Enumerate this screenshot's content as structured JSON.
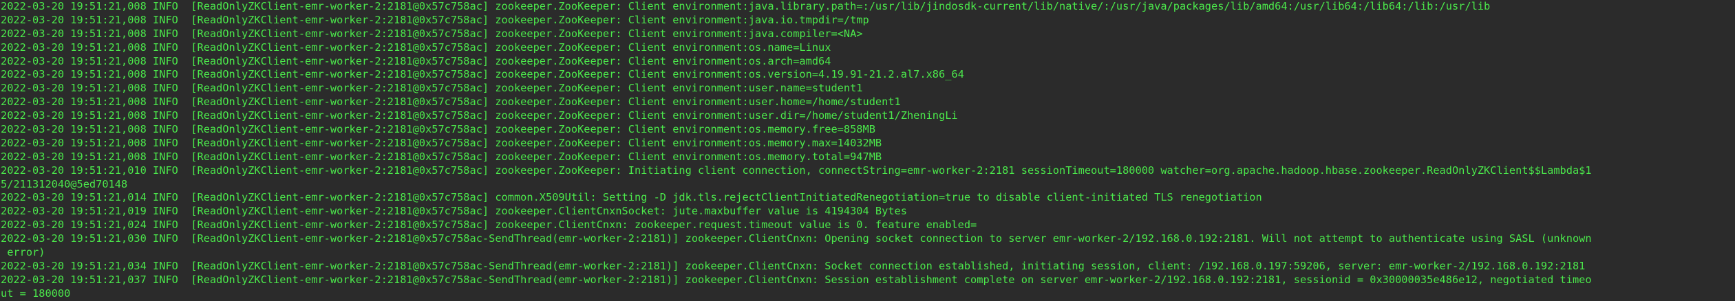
{
  "terminal": {
    "text_color": "#4be84b",
    "background_color": "#2b2b2b",
    "lines": [
      "2022-03-20 19:51:21,008 INFO  [ReadOnlyZKClient-emr-worker-2:2181@0x57c758ac] zookeeper.ZooKeeper: Client environment:java.library.path=:/usr/lib/jindosdk-current/lib/native/:/usr/java/packages/lib/amd64:/usr/lib64:/lib64:/lib:/usr/lib",
      "2022-03-20 19:51:21,008 INFO  [ReadOnlyZKClient-emr-worker-2:2181@0x57c758ac] zookeeper.ZooKeeper: Client environment:java.io.tmpdir=/tmp",
      "2022-03-20 19:51:21,008 INFO  [ReadOnlyZKClient-emr-worker-2:2181@0x57c758ac] zookeeper.ZooKeeper: Client environment:java.compiler=<NA>",
      "2022-03-20 19:51:21,008 INFO  [ReadOnlyZKClient-emr-worker-2:2181@0x57c758ac] zookeeper.ZooKeeper: Client environment:os.name=Linux",
      "2022-03-20 19:51:21,008 INFO  [ReadOnlyZKClient-emr-worker-2:2181@0x57c758ac] zookeeper.ZooKeeper: Client environment:os.arch=amd64",
      "2022-03-20 19:51:21,008 INFO  [ReadOnlyZKClient-emr-worker-2:2181@0x57c758ac] zookeeper.ZooKeeper: Client environment:os.version=4.19.91-21.2.al7.x86_64",
      "2022-03-20 19:51:21,008 INFO  [ReadOnlyZKClient-emr-worker-2:2181@0x57c758ac] zookeeper.ZooKeeper: Client environment:user.name=student1",
      "2022-03-20 19:51:21,008 INFO  [ReadOnlyZKClient-emr-worker-2:2181@0x57c758ac] zookeeper.ZooKeeper: Client environment:user.home=/home/student1",
      "2022-03-20 19:51:21,008 INFO  [ReadOnlyZKClient-emr-worker-2:2181@0x57c758ac] zookeeper.ZooKeeper: Client environment:user.dir=/home/student1/ZheningLi",
      "2022-03-20 19:51:21,008 INFO  [ReadOnlyZKClient-emr-worker-2:2181@0x57c758ac] zookeeper.ZooKeeper: Client environment:os.memory.free=858MB",
      "2022-03-20 19:51:21,008 INFO  [ReadOnlyZKClient-emr-worker-2:2181@0x57c758ac] zookeeper.ZooKeeper: Client environment:os.memory.max=14032MB",
      "2022-03-20 19:51:21,008 INFO  [ReadOnlyZKClient-emr-worker-2:2181@0x57c758ac] zookeeper.ZooKeeper: Client environment:os.memory.total=947MB",
      "2022-03-20 19:51:21,010 INFO  [ReadOnlyZKClient-emr-worker-2:2181@0x57c758ac] zookeeper.ZooKeeper: Initiating client connection, connectString=emr-worker-2:2181 sessionTimeout=180000 watcher=org.apache.hadoop.hbase.zookeeper.ReadOnlyZKClient$$Lambda$1",
      "5/211312040@5ed70148",
      "2022-03-20 19:51:21,014 INFO  [ReadOnlyZKClient-emr-worker-2:2181@0x57c758ac] common.X509Util: Setting -D jdk.tls.rejectClientInitiatedRenegotiation=true to disable client-initiated TLS renegotiation",
      "2022-03-20 19:51:21,019 INFO  [ReadOnlyZKClient-emr-worker-2:2181@0x57c758ac] zookeeper.ClientCnxnSocket: jute.maxbuffer value is 4194304 Bytes",
      "2022-03-20 19:51:21,024 INFO  [ReadOnlyZKClient-emr-worker-2:2181@0x57c758ac] zookeeper.ClientCnxn: zookeeper.request.timeout value is 0. feature enabled=",
      "2022-03-20 19:51:21,030 INFO  [ReadOnlyZKClient-emr-worker-2:2181@0x57c758ac-SendThread(emr-worker-2:2181)] zookeeper.ClientCnxn: Opening socket connection to server emr-worker-2/192.168.0.192:2181. Will not attempt to authenticate using SASL (unknown",
      " error)",
      "2022-03-20 19:51:21,034 INFO  [ReadOnlyZKClient-emr-worker-2:2181@0x57c758ac-SendThread(emr-worker-2:2181)] zookeeper.ClientCnxn: Socket connection established, initiating session, client: /192.168.0.197:59206, server: emr-worker-2/192.168.0.192:2181",
      "2022-03-20 19:51:21,037 INFO  [ReadOnlyZKClient-emr-worker-2:2181@0x57c758ac-SendThread(emr-worker-2:2181)] zookeeper.ClientCnxn: Session establishment complete on server emr-worker-2/192.168.0.192:2181, sessionid = 0x30000035e486e12, negotiated timeo",
      "ut = 180000"
    ]
  }
}
